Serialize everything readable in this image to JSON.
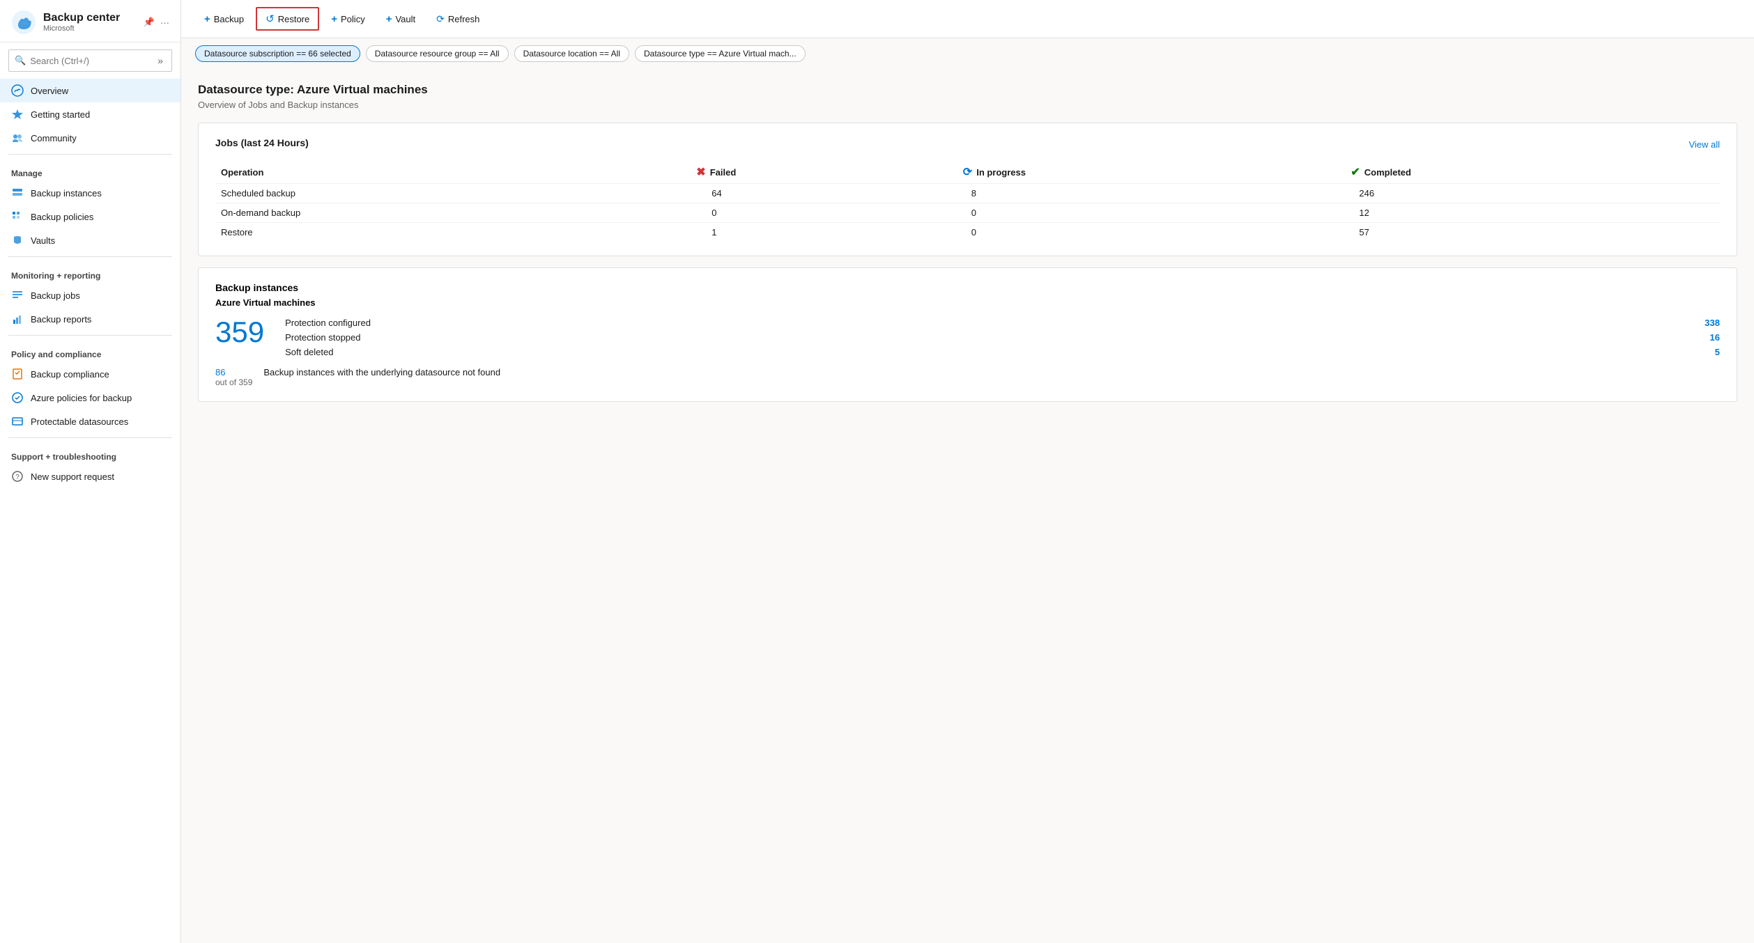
{
  "app": {
    "title": "Backup center",
    "subtitle": "Microsoft"
  },
  "sidebar": {
    "search_placeholder": "Search (Ctrl+/)",
    "nav_items": [
      {
        "id": "overview",
        "label": "Overview",
        "icon": "cloud",
        "active": true,
        "section": null
      },
      {
        "id": "getting-started",
        "label": "Getting started",
        "icon": "rocket",
        "active": false,
        "section": null
      },
      {
        "id": "community",
        "label": "Community",
        "icon": "community",
        "active": false,
        "section": null
      }
    ],
    "sections": [
      {
        "label": "Manage",
        "items": [
          {
            "id": "backup-instances",
            "label": "Backup instances",
            "icon": "instances"
          },
          {
            "id": "backup-policies",
            "label": "Backup policies",
            "icon": "policies"
          },
          {
            "id": "vaults",
            "label": "Vaults",
            "icon": "vaults"
          }
        ]
      },
      {
        "label": "Monitoring + reporting",
        "items": [
          {
            "id": "backup-jobs",
            "label": "Backup jobs",
            "icon": "jobs"
          },
          {
            "id": "backup-reports",
            "label": "Backup reports",
            "icon": "reports"
          }
        ]
      },
      {
        "label": "Policy and compliance",
        "items": [
          {
            "id": "backup-compliance",
            "label": "Backup compliance",
            "icon": "compliance"
          },
          {
            "id": "azure-policies",
            "label": "Azure policies for backup",
            "icon": "azure-policies"
          },
          {
            "id": "protectable-datasources",
            "label": "Protectable datasources",
            "icon": "datasources"
          }
        ]
      },
      {
        "label": "Support + troubleshooting",
        "items": [
          {
            "id": "new-support-request",
            "label": "New support request",
            "icon": "support"
          }
        ]
      }
    ]
  },
  "toolbar": {
    "backup_label": "+ Backup",
    "restore_label": "Restore",
    "policy_label": "+ Policy",
    "vault_label": "+ Vault",
    "refresh_label": "Refresh"
  },
  "filters": [
    {
      "id": "subscription",
      "label": "Datasource subscription == 66 selected",
      "highlighted": true
    },
    {
      "id": "resource-group",
      "label": "Datasource resource group == All",
      "highlighted": false
    },
    {
      "id": "location",
      "label": "Datasource location == All",
      "highlighted": false
    },
    {
      "id": "datasource-type",
      "label": "Datasource type == Azure Virtual mach...",
      "highlighted": false
    }
  ],
  "main": {
    "page_title": "Datasource type: Azure Virtual machines",
    "page_subtitle": "Overview of Jobs and Backup instances",
    "jobs_card": {
      "title": "Jobs (last 24 Hours)",
      "view_all": "View all",
      "columns": {
        "operation": "Operation",
        "failed": "Failed",
        "in_progress": "In progress",
        "completed": "Completed"
      },
      "rows": [
        {
          "operation": "Scheduled backup",
          "failed": "64",
          "in_progress": "8",
          "completed": "246",
          "failed_zero": false,
          "in_progress_zero": false,
          "completed_zero": false
        },
        {
          "operation": "On-demand backup",
          "failed": "0",
          "in_progress": "0",
          "completed": "12",
          "failed_zero": true,
          "in_progress_zero": true,
          "completed_zero": false
        },
        {
          "operation": "Restore",
          "failed": "1",
          "in_progress": "0",
          "completed": "57",
          "failed_zero": false,
          "in_progress_zero": true,
          "completed_zero": false
        }
      ]
    },
    "backup_instances_card": {
      "title": "Backup instances",
      "vm_title": "Azure Virtual machines",
      "total": "359",
      "protection_configured_label": "Protection configured",
      "protection_configured_val": "338",
      "protection_stopped_label": "Protection stopped",
      "protection_stopped_val": "16",
      "soft_deleted_label": "Soft deleted",
      "soft_deleted_val": "5",
      "footer_num": "86",
      "footer_sub": "out of 359",
      "footer_text": "Backup instances with the underlying datasource not found"
    }
  }
}
